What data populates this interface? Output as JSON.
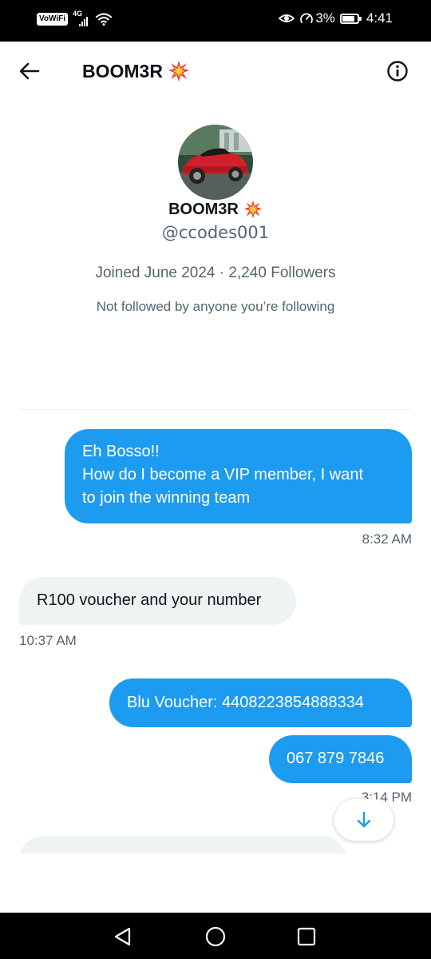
{
  "status_bar": {
    "vowifi": "VoWiFi",
    "network": "4G",
    "data_saver_percent": "3%",
    "time": "4:41",
    "battery_level": 0.85
  },
  "header": {
    "title": "BOOM3R"
  },
  "profile": {
    "name": "BOOM3R",
    "handle": "@ccodes001",
    "joined": "Joined June 2024",
    "separator": "·",
    "followers": "2,240 Followers",
    "note": "Not followed by anyone you’re following"
  },
  "messages": [
    {
      "direction": "outgoing",
      "lines": [
        "Eh Bosso!!",
        "How do I become a VIP member, I want",
        "to join the winning team"
      ],
      "time": "8:32 AM"
    },
    {
      "direction": "incoming",
      "text": "R100 voucher and your number",
      "time": "10:37 AM"
    },
    {
      "direction": "outgoing",
      "text": "Blu Voucher: 4408223854888334"
    },
    {
      "direction": "outgoing",
      "text": "067 879 7846",
      "time": "3:14 PM"
    }
  ],
  "colors": {
    "accent": "#1d9bf0",
    "incoming_bubble": "#eff3f4",
    "secondary_text": "#536471",
    "primary_text": "#0f1419"
  },
  "icons": {
    "back": "arrow-left-icon",
    "title_emoji": "collision-icon",
    "info": "info-icon",
    "scroll": "arrow-down-icon",
    "nav_back": "triangle-back-icon",
    "nav_home": "circle-home-icon",
    "nav_recent": "square-recent-icon"
  }
}
